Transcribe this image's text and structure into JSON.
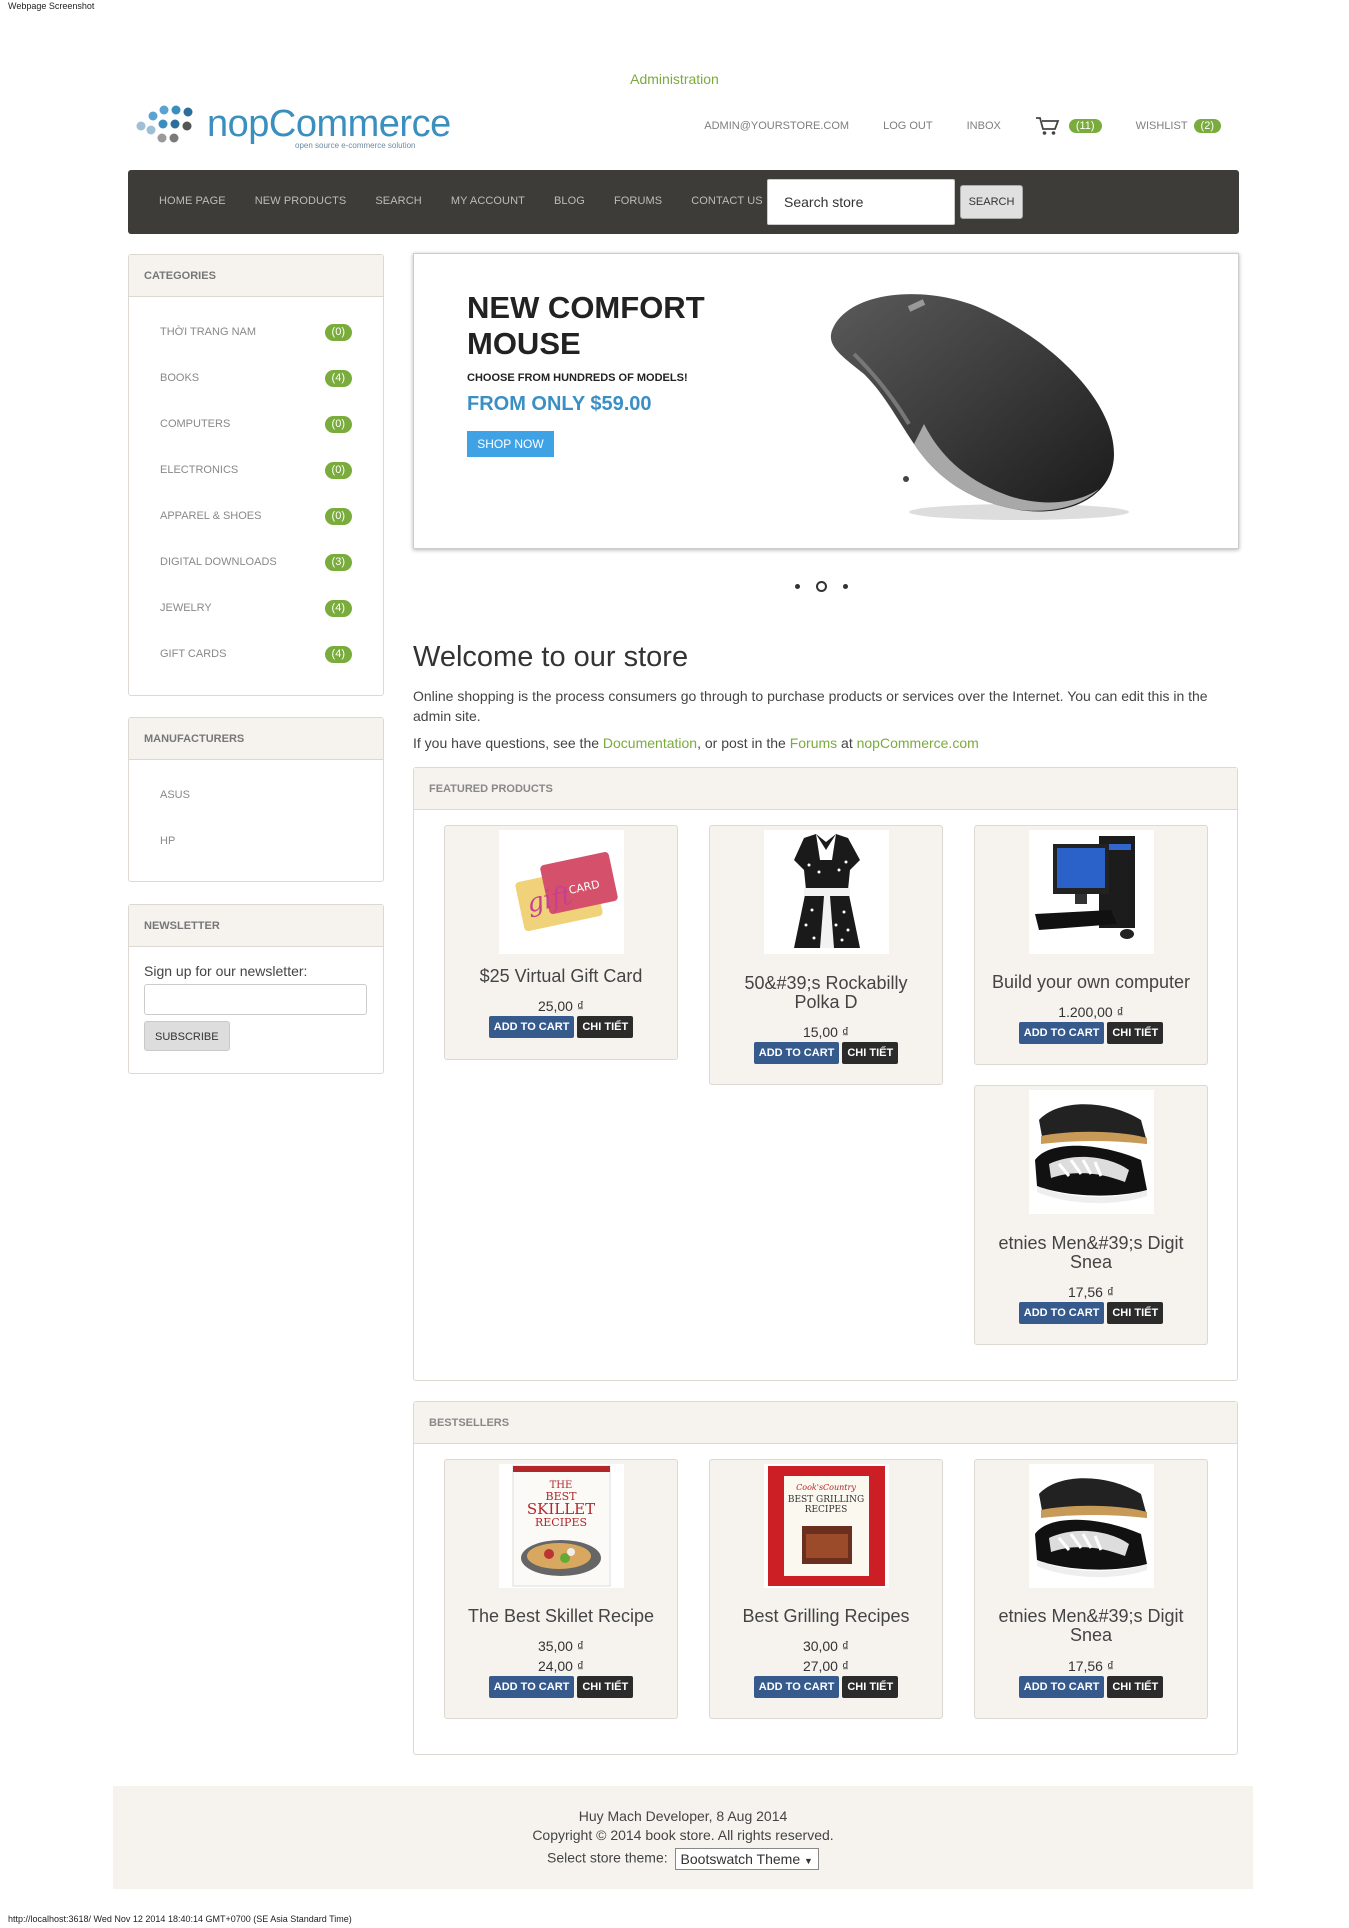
{
  "captions": {
    "top": "Webpage Screenshot",
    "bottom": "http://localhost:3618/ Wed Nov 12 2014 18:40:14 GMT+0700 (SE Asia Standard Time)"
  },
  "header": {
    "admin_link": "Administration",
    "logo_text": "nopCommerce",
    "logo_subtitle": "open source e-commerce solution",
    "account": "ADMIN@YOURSTORE.COM",
    "logout": "LOG OUT",
    "inbox": "INBOX",
    "cart_count": "(11)",
    "wishlist": "WISHLIST",
    "wishlist_count": "(2)"
  },
  "nav": {
    "items": [
      "HOME PAGE",
      "NEW PRODUCTS",
      "SEARCH",
      "MY ACCOUNT",
      "BLOG",
      "FORUMS",
      "CONTACT US"
    ],
    "search_value": "Search store",
    "search_button": "SEARCH"
  },
  "categories": {
    "title": "CATEGORIES",
    "items": [
      {
        "label": "THỜI TRANG NAM",
        "count": "(0)"
      },
      {
        "label": "BOOKS",
        "count": "(4)"
      },
      {
        "label": "COMPUTERS",
        "count": "(0)"
      },
      {
        "label": "ELECTRONICS",
        "count": "(0)"
      },
      {
        "label": "APPAREL & SHOES",
        "count": "(0)"
      },
      {
        "label": "DIGITAL DOWNLOADS",
        "count": "(3)"
      },
      {
        "label": "JEWELRY",
        "count": "(4)"
      },
      {
        "label": "GIFT CARDS",
        "count": "(4)"
      }
    ]
  },
  "manufacturers": {
    "title": "MANUFACTURERS",
    "items": [
      "ASUS",
      "HP"
    ]
  },
  "newsletter": {
    "title": "NEWSLETTER",
    "label": "Sign up for our newsletter:",
    "input_value": "",
    "button": "SUBSCRIBE"
  },
  "slider": {
    "title": "NEW COMFORT MOUSE",
    "subtitle": "CHOOSE FROM HUNDREDS OF MODELS!",
    "price": "FROM ONLY $59.00",
    "button": "SHOP NOW",
    "active_slide": 2,
    "slide_count": 3
  },
  "welcome": {
    "title": "Welcome to our store",
    "text": "Online shopping is the process consumers go through to purchase products or services over the Internet. You can edit this in the admin site.",
    "q_prefix": "If you have questions, see the",
    "doc_link": "Documentation",
    "q_mid": ", or post in the",
    "forums_link": "Forums",
    "q_at": "at",
    "site_link": "nopCommerce.com"
  },
  "featured": {
    "title": "FEATURED PRODUCTS",
    "products": [
      {
        "name": "$25 Virtual Gift Card",
        "price": "25,00 ₫",
        "add": "ADD TO CART",
        "details": "CHI TIẾT",
        "image": "gift-card-image"
      },
      {
        "name": "50&#39;s Rockabilly Polka D",
        "price": "15,00 ₫",
        "add": "ADD TO CART",
        "details": "CHI TIẾT",
        "image": "polka-dress-image"
      },
      {
        "name": "Build your own computer",
        "price": "1.200,00 ₫",
        "add": "ADD TO CART",
        "details": "CHI TIẾT",
        "image": "computer-image"
      },
      {
        "name": "etnies Men&#39;s Digit Snea",
        "price": "17,56 ₫",
        "add": "ADD TO CART",
        "details": "CHI TIẾT",
        "image": "sneaker-image"
      }
    ]
  },
  "bestsellers": {
    "title": "BESTSELLERS",
    "products": [
      {
        "name": "The Best Skillet Recipe",
        "old_price": "35,00 ₫",
        "price": "24,00 ₫",
        "add": "ADD TO CART",
        "details": "CHI TIẾT",
        "image": "skillet-book-image"
      },
      {
        "name": "Best Grilling Recipes",
        "old_price": "30,00 ₫",
        "price": "27,00 ₫",
        "add": "ADD TO CART",
        "details": "CHI TIẾT",
        "image": "grilling-book-image"
      },
      {
        "name": "etnies Men&#39;s Digit Snea",
        "price": "17,56 ₫",
        "add": "ADD TO CART",
        "details": "CHI TIẾT",
        "image": "sneaker-image"
      }
    ]
  },
  "footer": {
    "line1": "Huy Mach Developer, 8 Aug 2014",
    "line2": "Copyright © 2014 book store. All rights reserved.",
    "theme_label": "Select store theme:",
    "theme_value": "Bootswatch Theme"
  },
  "colors": {
    "accent_green": "#7aab3d",
    "nav_bg": "#3d3c38",
    "add_to_cart_blue": "#365a8c",
    "price_blue": "#3a8fc5",
    "panel_bg": "#f6f3ee"
  }
}
